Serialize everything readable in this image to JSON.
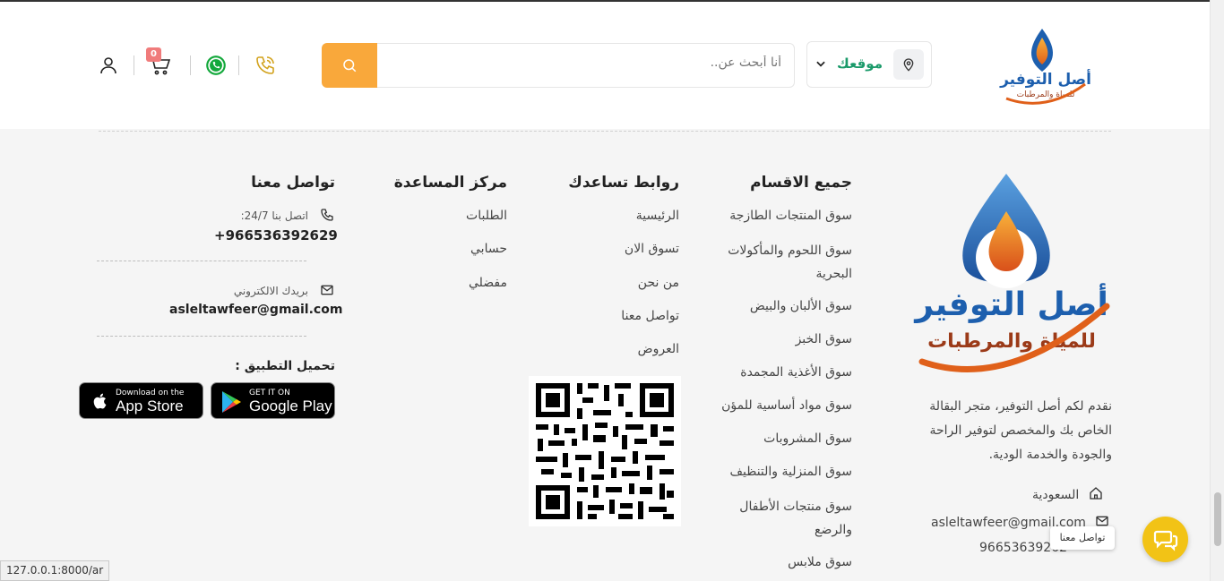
{
  "header": {
    "logo_alt": "أصل التوفير للمياة والمرطبات",
    "location_label": "موقعك",
    "search_placeholder": "أنا أبحث عن..",
    "cart_count": "0",
    "icons": [
      "location-pin-icon",
      "chevron-down-icon",
      "search-icon",
      "phone-icon",
      "whatsapp-icon",
      "cart-icon",
      "user-icon"
    ],
    "accent_color": "#f9a83b",
    "location_color": "#1a9a6a"
  },
  "brand": {
    "name": "أصل التوفير",
    "tagline": "للمياة والمرطبات",
    "about": "نقدم لكم أصل التوفير، متجر البقالة الخاص بك والمخصص لتوفير الراحة والجودة والخدمة الودية.",
    "country": "السعودية",
    "email": "asleltawfeer@gmail.com",
    "phone": "96653639262"
  },
  "categories": {
    "title": "جميع الاقسام",
    "items": [
      "سوق المنتجات الطازجة",
      "سوق اللحوم والمأكولات البحرية",
      "سوق الألبان والبيض",
      "سوق الخبز",
      "سوق الأغذية المجمدة",
      "سوق مواد أساسية للمؤن",
      "سوق المشروبات",
      "سوق المنزلية والتنظيف",
      "سوق منتجات الأطفال والرضع",
      "سوق ملابس"
    ]
  },
  "useful_links": {
    "title": "روابط تساعدك",
    "items": [
      "الرئيسية",
      "تسوق الان",
      "من نحن",
      "تواصل معنا",
      "العروض"
    ]
  },
  "help_center": {
    "title": "مركز المساعدة",
    "items": [
      "الطلبات",
      "حسابي",
      "مفضلي"
    ]
  },
  "contact": {
    "title": "تواصل معنا",
    "call_label": "اتصل بنا 24/7:",
    "call_value": "+966536392629",
    "email_label": "بريدك الالكتروني",
    "email_value": "asleltawfeer@gmail.com",
    "app_title": "تحميل التطبيق :",
    "appstore_small": "Download on the",
    "appstore_big": "App Store",
    "googleplay_small": "GET IT ON",
    "googleplay_big": "Google Play"
  },
  "chat": {
    "tooltip": "تواصل معنا",
    "color": "#f2c316"
  },
  "status_bar_url": "127.0.0.1:8000/ar"
}
